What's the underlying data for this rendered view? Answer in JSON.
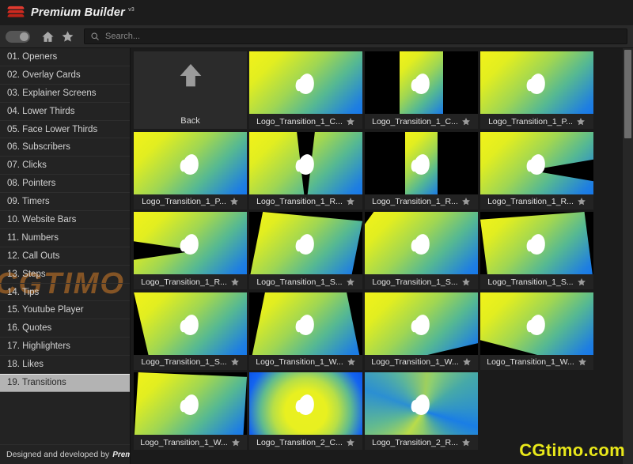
{
  "window": {
    "title": "Premium Builder",
    "version": "v3",
    "logo_icon": "stack-icon"
  },
  "toolbar": {
    "toggle": {
      "name": "theme-toggle",
      "state": "on"
    },
    "home_icon": "home-icon",
    "favorites_icon": "star-icon",
    "search_icon": "search-icon",
    "search_placeholder": "Search...",
    "search_value": ""
  },
  "sidebar": {
    "items": [
      {
        "label": "01. Openers",
        "selected": false
      },
      {
        "label": "02. Overlay Cards",
        "selected": false
      },
      {
        "label": "03. Explainer Screens",
        "selected": false
      },
      {
        "label": "04. Lower Thirds",
        "selected": false
      },
      {
        "label": "05. Face Lower Thirds",
        "selected": false
      },
      {
        "label": "06. Subscribers",
        "selected": false
      },
      {
        "label": "07. Clicks",
        "selected": false
      },
      {
        "label": "08. Pointers",
        "selected": false
      },
      {
        "label": "09. Timers",
        "selected": false
      },
      {
        "label": "10. Website Bars",
        "selected": false
      },
      {
        "label": "11. Numbers",
        "selected": false
      },
      {
        "label": "12. Call Outs",
        "selected": false
      },
      {
        "label": "13. Steps",
        "selected": false
      },
      {
        "label": "14. Tips",
        "selected": false
      },
      {
        "label": "15. Youtube Player",
        "selected": false
      },
      {
        "label": "16. Quotes",
        "selected": false
      },
      {
        "label": "17. Highlighters",
        "selected": false
      },
      {
        "label": "18. Likes",
        "selected": false
      },
      {
        "label": "19. Transitions",
        "selected": true
      }
    ],
    "footer_text": "Designed and developed by",
    "footer_brand": "Premiumilk."
  },
  "grid": {
    "back": {
      "label": "Back",
      "icon": "arrow-up-icon"
    },
    "items": [
      {
        "label": "Logo_Transition_1_C...",
        "star": "star-icon",
        "art": "g-diag",
        "clip": "clip-full"
      },
      {
        "label": "Logo_Transition_1_C...",
        "star": "star-icon",
        "art": "g-diag",
        "clip": "clip-strip"
      },
      {
        "label": "Logo_Transition_1_P...",
        "star": "star-icon",
        "art": "g-diag",
        "clip": "clip-full"
      },
      {
        "label": "Logo_Transition_1_P...",
        "star": "star-icon",
        "art": "g-diag",
        "clip": "clip-full"
      },
      {
        "label": "Logo_Transition_1_R...",
        "star": "star-icon",
        "art": "g-diag",
        "clip": "clip-wedge"
      },
      {
        "label": "Logo_Transition_1_R...",
        "star": "star-icon",
        "art": "g-diag",
        "clip": "clip-nar"
      },
      {
        "label": "Logo_Transition_1_R...",
        "star": "star-icon",
        "art": "g-diag",
        "clip": "clip-wedgeR"
      },
      {
        "label": "Logo_Transition_1_R...",
        "star": "star-icon",
        "art": "g-diag",
        "clip": "clip-wedgeL"
      },
      {
        "label": "Logo_Transition_1_S...",
        "star": "star-icon",
        "art": "g-diag",
        "clip": "clip-rot1"
      },
      {
        "label": "Logo_Transition_1_S...",
        "star": "star-icon",
        "art": "g-diag",
        "clip": "clip-hex"
      },
      {
        "label": "Logo_Transition_1_S...",
        "star": "star-icon",
        "art": "g-diag",
        "clip": "clip-rot2"
      },
      {
        "label": "Logo_Transition_1_S...",
        "star": "star-icon",
        "art": "g-diag",
        "clip": "clip-tri"
      },
      {
        "label": "Logo_Transition_1_W...",
        "star": "star-icon",
        "art": "g-diag",
        "clip": "clip-trapz"
      },
      {
        "label": "Logo_Transition_1_W...",
        "star": "star-icon",
        "art": "g-diag",
        "clip": "clip-half"
      },
      {
        "label": "Logo_Transition_1_W...",
        "star": "star-icon",
        "art": "g-diag",
        "clip": "clip-diagcut"
      },
      {
        "label": "Logo_Transition_1_W...",
        "star": "star-icon",
        "art": "g-diag",
        "clip": "clip-rot3"
      },
      {
        "label": "Logo_Transition_2_C...",
        "star": "star-icon",
        "art": "g-radial",
        "clip": "clip-full"
      },
      {
        "label": "Logo_Transition_2_R...",
        "star": "star-icon",
        "art": "g-conic",
        "clip": "clip-full"
      }
    ]
  },
  "watermarks": {
    "sidebar": "CGTIMO",
    "bottom": "CGtimo.com"
  }
}
